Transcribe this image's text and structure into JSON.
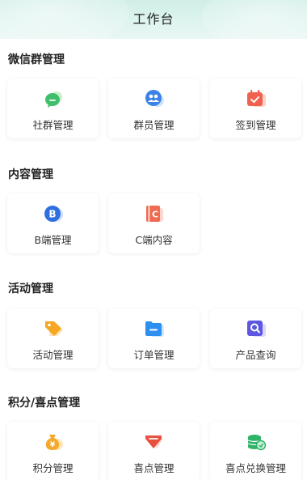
{
  "header": {
    "title": "工作台"
  },
  "sections": [
    {
      "title": "微信群管理",
      "items": [
        {
          "label": "社群管理",
          "icon": "chat-bubble-icon"
        },
        {
          "label": "群员管理",
          "icon": "people-icon"
        },
        {
          "label": "签到管理",
          "icon": "calendar-check-icon"
        }
      ]
    },
    {
      "title": "内容管理",
      "items": [
        {
          "label": "B端管理",
          "icon": "letter-b-icon"
        },
        {
          "label": "C端内容",
          "icon": "letter-c-icon"
        }
      ]
    },
    {
      "title": "活动管理",
      "items": [
        {
          "label": "活动管理",
          "icon": "tag-icon"
        },
        {
          "label": "订单管理",
          "icon": "folder-icon"
        },
        {
          "label": "产品查询",
          "icon": "search-icon"
        }
      ]
    },
    {
      "title": "积分/喜点管理",
      "items": [
        {
          "label": "积分管理",
          "icon": "money-bag-icon"
        },
        {
          "label": "喜点管理",
          "icon": "gem-icon"
        },
        {
          "label": "喜点兑换管理",
          "icon": "coins-icon"
        }
      ]
    }
  ]
}
